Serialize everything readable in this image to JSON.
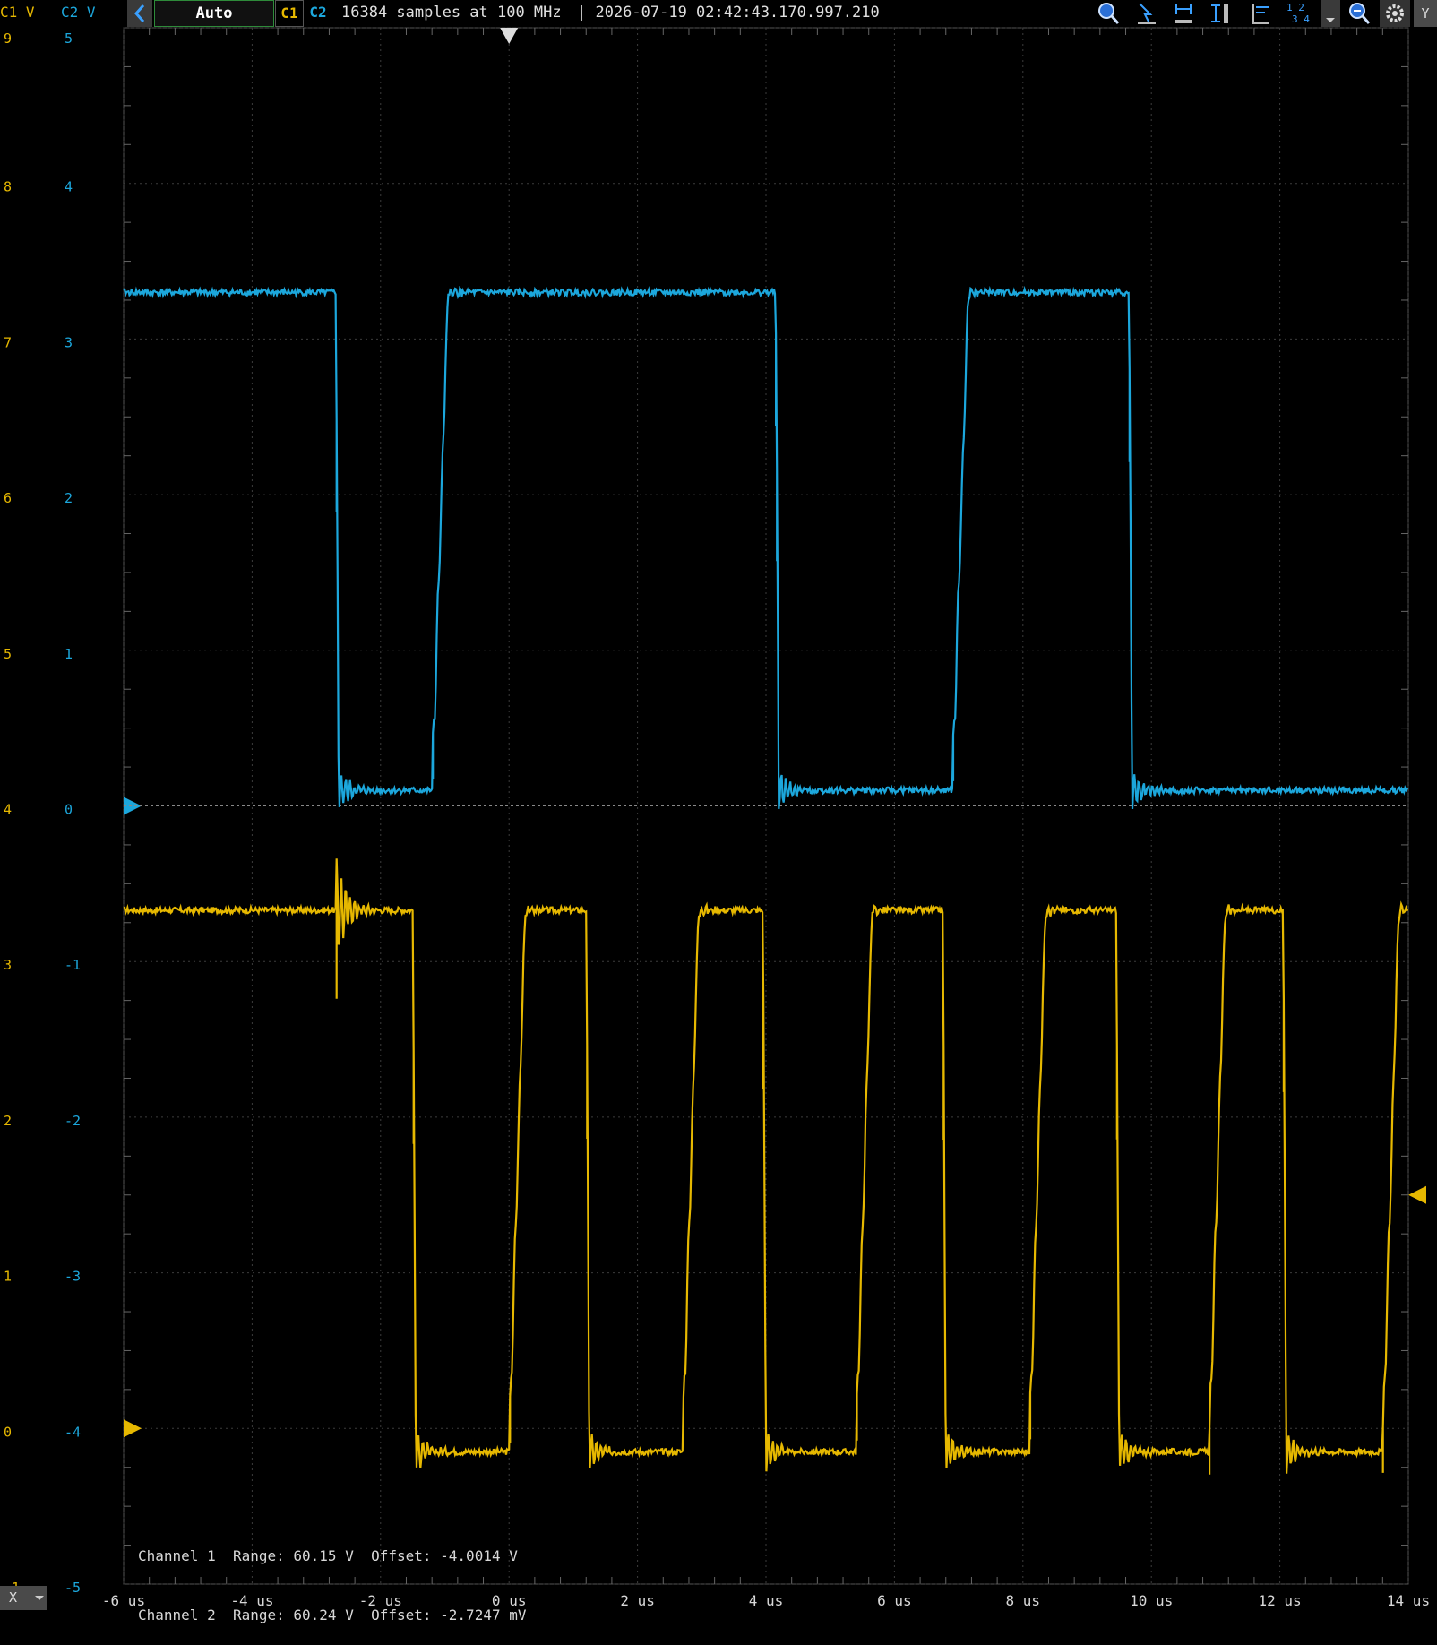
{
  "toolbar": {
    "mode": "Auto",
    "ch1_button": "C1",
    "ch2_button": "C2",
    "sample_info": "16384 samples at 100 MHz",
    "timestamp": "| 2026-07-19 02:42:43.170.997.210",
    "quad_label_top": "1 2",
    "quad_label_bottom": "3 4",
    "y_button": "Y",
    "icons": [
      "back-arrow-icon",
      "zoom-in-icon",
      "cursor-arrow-icon",
      "horizontal-cursor-icon",
      "vertical-cursor-icon",
      "measure-icon",
      "channel-layout-icon",
      "dropdown-icon",
      "zoom-out-icon",
      "gear-icon"
    ]
  },
  "axis_headers": {
    "c1": "C1 V",
    "c2": "C2 V"
  },
  "bottom": {
    "x_selector": "X"
  },
  "info_lines": [
    {
      "channel": "Channel 1",
      "range": "Range: 60.15 V",
      "offset": "Offset: -4.0014 V"
    },
    {
      "channel": "Channel 2",
      "range": "Range: 60.24 V",
      "offset": "Offset: -2.7247 mV"
    }
  ],
  "colors": {
    "c1": "#e6b800",
    "c2": "#1ca7dc",
    "grid": "#3c3c3c",
    "background": "#000000",
    "selected_box": "#2e8b3a"
  },
  "chart_data": {
    "type": "line",
    "title": "",
    "xlabel": "",
    "ylabel": "",
    "x_ticks": [
      "-6 us",
      "-4 us",
      "-2 us",
      "0 us",
      "2 us",
      "4 us",
      "6 us",
      "8 us",
      "10 us",
      "12 us",
      "14 us"
    ],
    "xlim": [
      -6,
      14
    ],
    "c1_ticks": [
      "9",
      "8",
      "7",
      "6",
      "5",
      "4",
      "3",
      "2",
      "1",
      "0",
      "-1"
    ],
    "c2_ticks": [
      "5",
      "4",
      "3",
      "2",
      "1",
      "0",
      "-1",
      "-2",
      "-3",
      "-4",
      "-5"
    ],
    "c1_ylim": [
      -1,
      9
    ],
    "c2_ylim": [
      -5,
      5
    ],
    "grid": true,
    "trigger_time": 0,
    "series": [
      {
        "name": "C1",
        "axis": "c1",
        "high": 3.33,
        "low": -0.15,
        "start_level": 3.33,
        "transitions": [
          {
            "t": -2.7,
            "to": "ring"
          },
          {
            "t": -1.5,
            "to": "low"
          },
          {
            "t": 0.0,
            "to": "high"
          },
          {
            "t": 1.2,
            "to": "low"
          },
          {
            "t": 2.7,
            "to": "high"
          },
          {
            "t": 3.95,
            "to": "low"
          },
          {
            "t": 5.4,
            "to": "high"
          },
          {
            "t": 6.75,
            "to": "low"
          },
          {
            "t": 8.1,
            "to": "high"
          },
          {
            "t": 9.45,
            "to": "low"
          },
          {
            "t": 10.9,
            "to": "high"
          },
          {
            "t": 12.05,
            "to": "low"
          },
          {
            "t": 13.6,
            "to": "high"
          }
        ]
      },
      {
        "name": "C2",
        "axis": "c2",
        "high": 3.3,
        "low": 0.1,
        "start_level": 3.3,
        "transitions": [
          {
            "t": -2.7,
            "to": "low"
          },
          {
            "t": -1.2,
            "to": "high"
          },
          {
            "t": 4.15,
            "to": "low"
          },
          {
            "t": 6.9,
            "to": "high"
          },
          {
            "t": 9.65,
            "to": "low"
          }
        ]
      }
    ]
  }
}
